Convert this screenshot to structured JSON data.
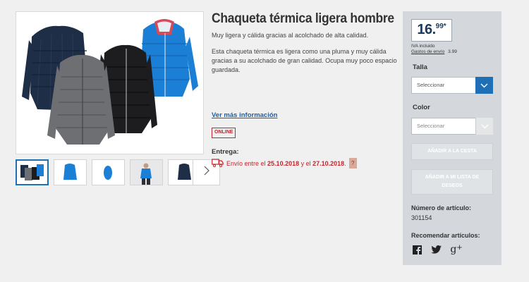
{
  "product": {
    "title": "Chaqueta térmica ligera hombre",
    "subtitle": "Muy ligera y cálida gracias al acolchado de alta calidad.",
    "description": "Esta chaqueta térmica es ligera como una pluma y muy cálida gracias a su acolchado de gran calidad. Ocupa muy poco espacio guardada.",
    "more_info_link": "Ver más información",
    "badge": "ONLINE"
  },
  "delivery": {
    "label": "Entrega:",
    "prefix": "Envío entre el ",
    "date_from": "25.10.2018",
    "middle": " y el ",
    "date_to": "27.10.2018",
    "suffix": ".",
    "help": "?"
  },
  "pricing": {
    "integer": "16.",
    "decimal": "99*",
    "vat_note": "IVA incluido",
    "shipping_label": "Gastos de envío",
    "shipping_cost": "3.99"
  },
  "size_select": {
    "label": "Talla",
    "value": "Seleccionar"
  },
  "color_select": {
    "label": "Color",
    "value": "Seleccionar"
  },
  "buttons": {
    "add_to_cart": "AÑADIR A LA CESTA",
    "add_to_list": "AÑADIR A MI LISTA DE DESEOS"
  },
  "article": {
    "label": "Número de artículo:",
    "number": "301154"
  },
  "share": {
    "label": "Recomendar artículos:",
    "icons": [
      "facebook-icon",
      "twitter-icon",
      "google-plus-icon"
    ]
  },
  "gallery": {
    "thumbnails": [
      "four-jackets",
      "blue-jacket-front",
      "blue-jacket-pouch",
      "model-blue-jacket",
      "navy-jacket"
    ],
    "selected_index": 0
  },
  "colors": {
    "accent_blue": "#1e6fb5",
    "online_red": "#c0282e",
    "price_navy": "#1b3a5c"
  }
}
